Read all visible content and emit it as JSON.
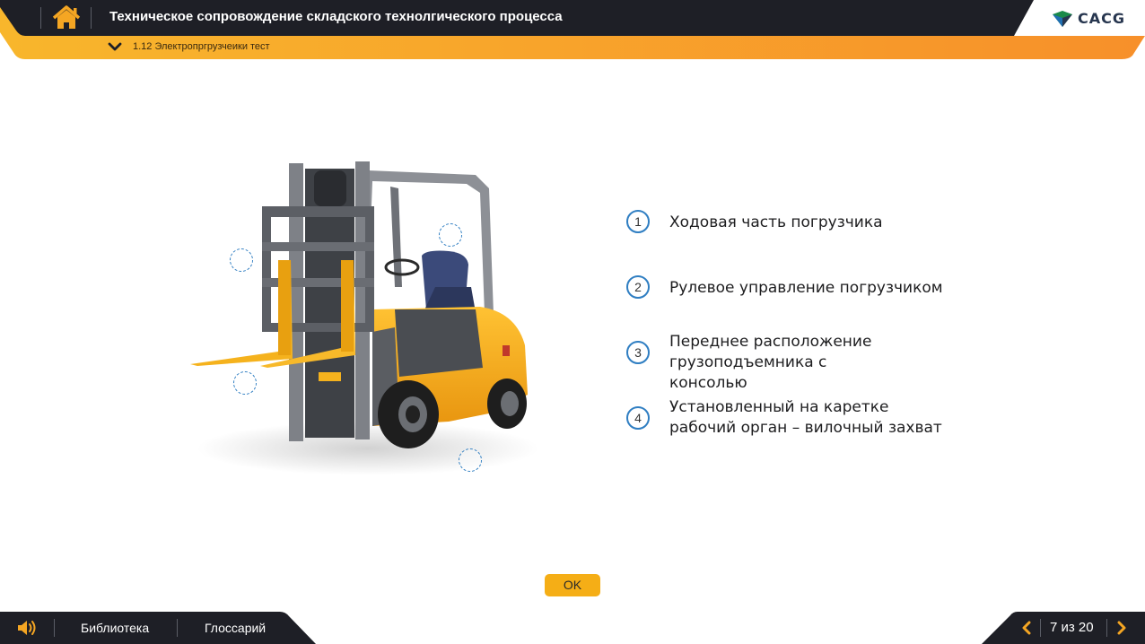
{
  "header": {
    "title": "Техническое сопровождение складского технолгического процесса",
    "subtitle": "1.12 Электропргрузчеики тест",
    "logo_text": "CACG",
    "home_icon": "home-icon",
    "accent_color": "#f5a623",
    "dark_color": "#1e1f26"
  },
  "main": {
    "items": [
      {
        "number": "1",
        "text": "Ходовая часть погрузчика"
      },
      {
        "number": "2",
        "text": "Рулевое управление погрузчиком"
      },
      {
        "number": "3",
        "text": "Переднее расположение грузоподъемника с консолью"
      },
      {
        "number": "4",
        "text": "Установленный на каретке рабочий орган – вилочный захват"
      }
    ],
    "ok_label": "OK"
  },
  "footer": {
    "library_label": "Библиотека",
    "glossary_label": "Глоссарий",
    "page_indicator": "7 из 20"
  }
}
